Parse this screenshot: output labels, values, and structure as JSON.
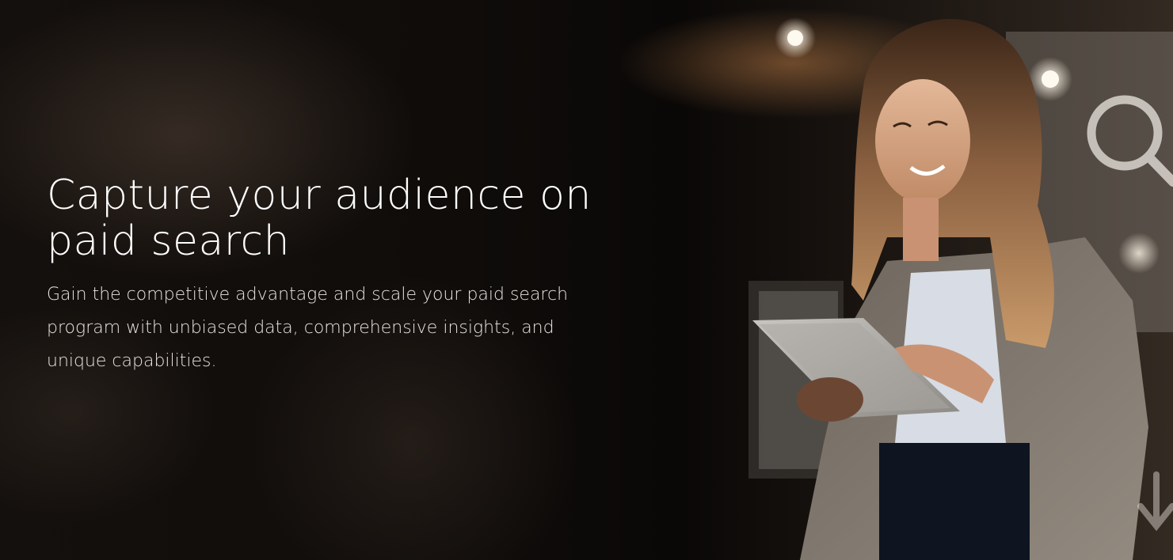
{
  "hero": {
    "headline": "Capture your audience on paid search",
    "subtext": "Gain the competitive advantage and scale your paid search program with unbiased data, comprehensive insights, and unique capabilities."
  },
  "colors": {
    "background": "#0b0908",
    "headline": "#ffffff",
    "subtext": "#e9e4df",
    "accent_light": "#f3ead9"
  },
  "icons": [
    "search-icon",
    "arrow-down-icon"
  ]
}
